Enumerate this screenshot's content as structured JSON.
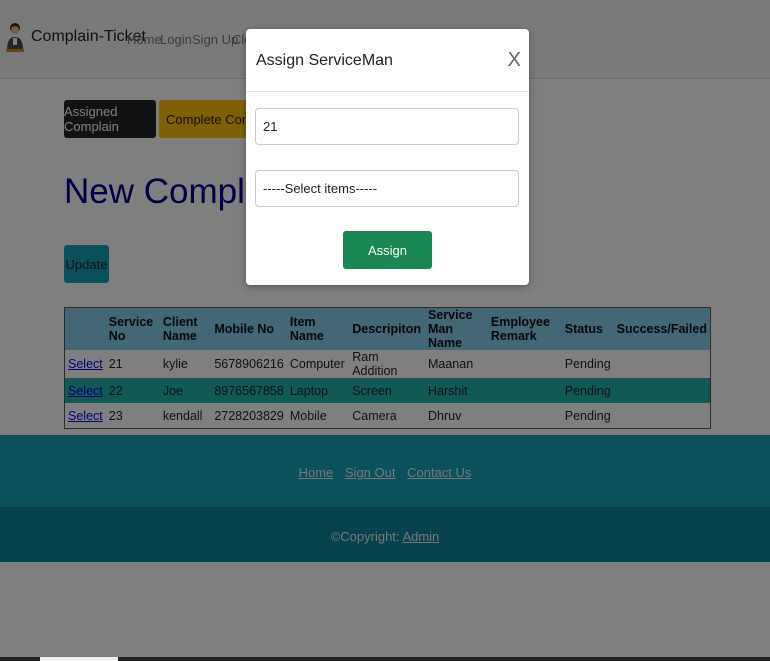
{
  "navbar": {
    "brand": "Complain-Ticket",
    "links": [
      "Home",
      "Login",
      "Sign Up",
      "Cle"
    ]
  },
  "actions": {
    "assigned_label": "Assigned Complain",
    "complete_label": "Complete Complain"
  },
  "page": {
    "title": "New Complain",
    "update_label": "Update"
  },
  "table": {
    "headers": [
      "",
      "Service No",
      "Client Name",
      "Mobile No",
      "Item Name",
      "Descripiton",
      "Service Man Name",
      "Employee Remark",
      "Status",
      "Success/Failed"
    ],
    "rows": [
      {
        "select": "Select",
        "service_no": "21",
        "client": "kylie",
        "mobile": "5678906216",
        "item": "Computer",
        "description": "Ram Addition",
        "serviceman": "Maanan",
        "remark": "",
        "status": "Pending",
        "result": ""
      },
      {
        "select": "Select",
        "service_no": "22",
        "client": "Joe",
        "mobile": "8976567858",
        "item": "Laptop",
        "description": "Screen",
        "serviceman": "Harshit",
        "remark": "",
        "status": "Pending",
        "result": ""
      },
      {
        "select": "Select",
        "service_no": "23",
        "client": "kendall",
        "mobile": "2728203829",
        "item": "Mobile",
        "description": "Camera",
        "serviceman": "Dhruv",
        "remark": "",
        "status": "Pending",
        "result": ""
      }
    ],
    "selected_row_index": 1
  },
  "footer": {
    "links": [
      "Home",
      "Sign Out",
      "Contact Us"
    ],
    "copyright_prefix": "©Copyright: ",
    "copyright_link": "Admin"
  },
  "modal": {
    "title": "Assign ServiceMan",
    "close_glyph": "X",
    "service_no_value": "21",
    "select_value": "-----Select items-----",
    "assign_label": "Assign"
  },
  "colors": {
    "title_blue": "#00008b",
    "header_bg": "#87ceeb",
    "selected_row": "#20b2aa",
    "footer_top": "#17a2b8",
    "footer_bottom": "#0c8597",
    "assign_green": "#198754",
    "warning_yellow": "#ffc107"
  }
}
